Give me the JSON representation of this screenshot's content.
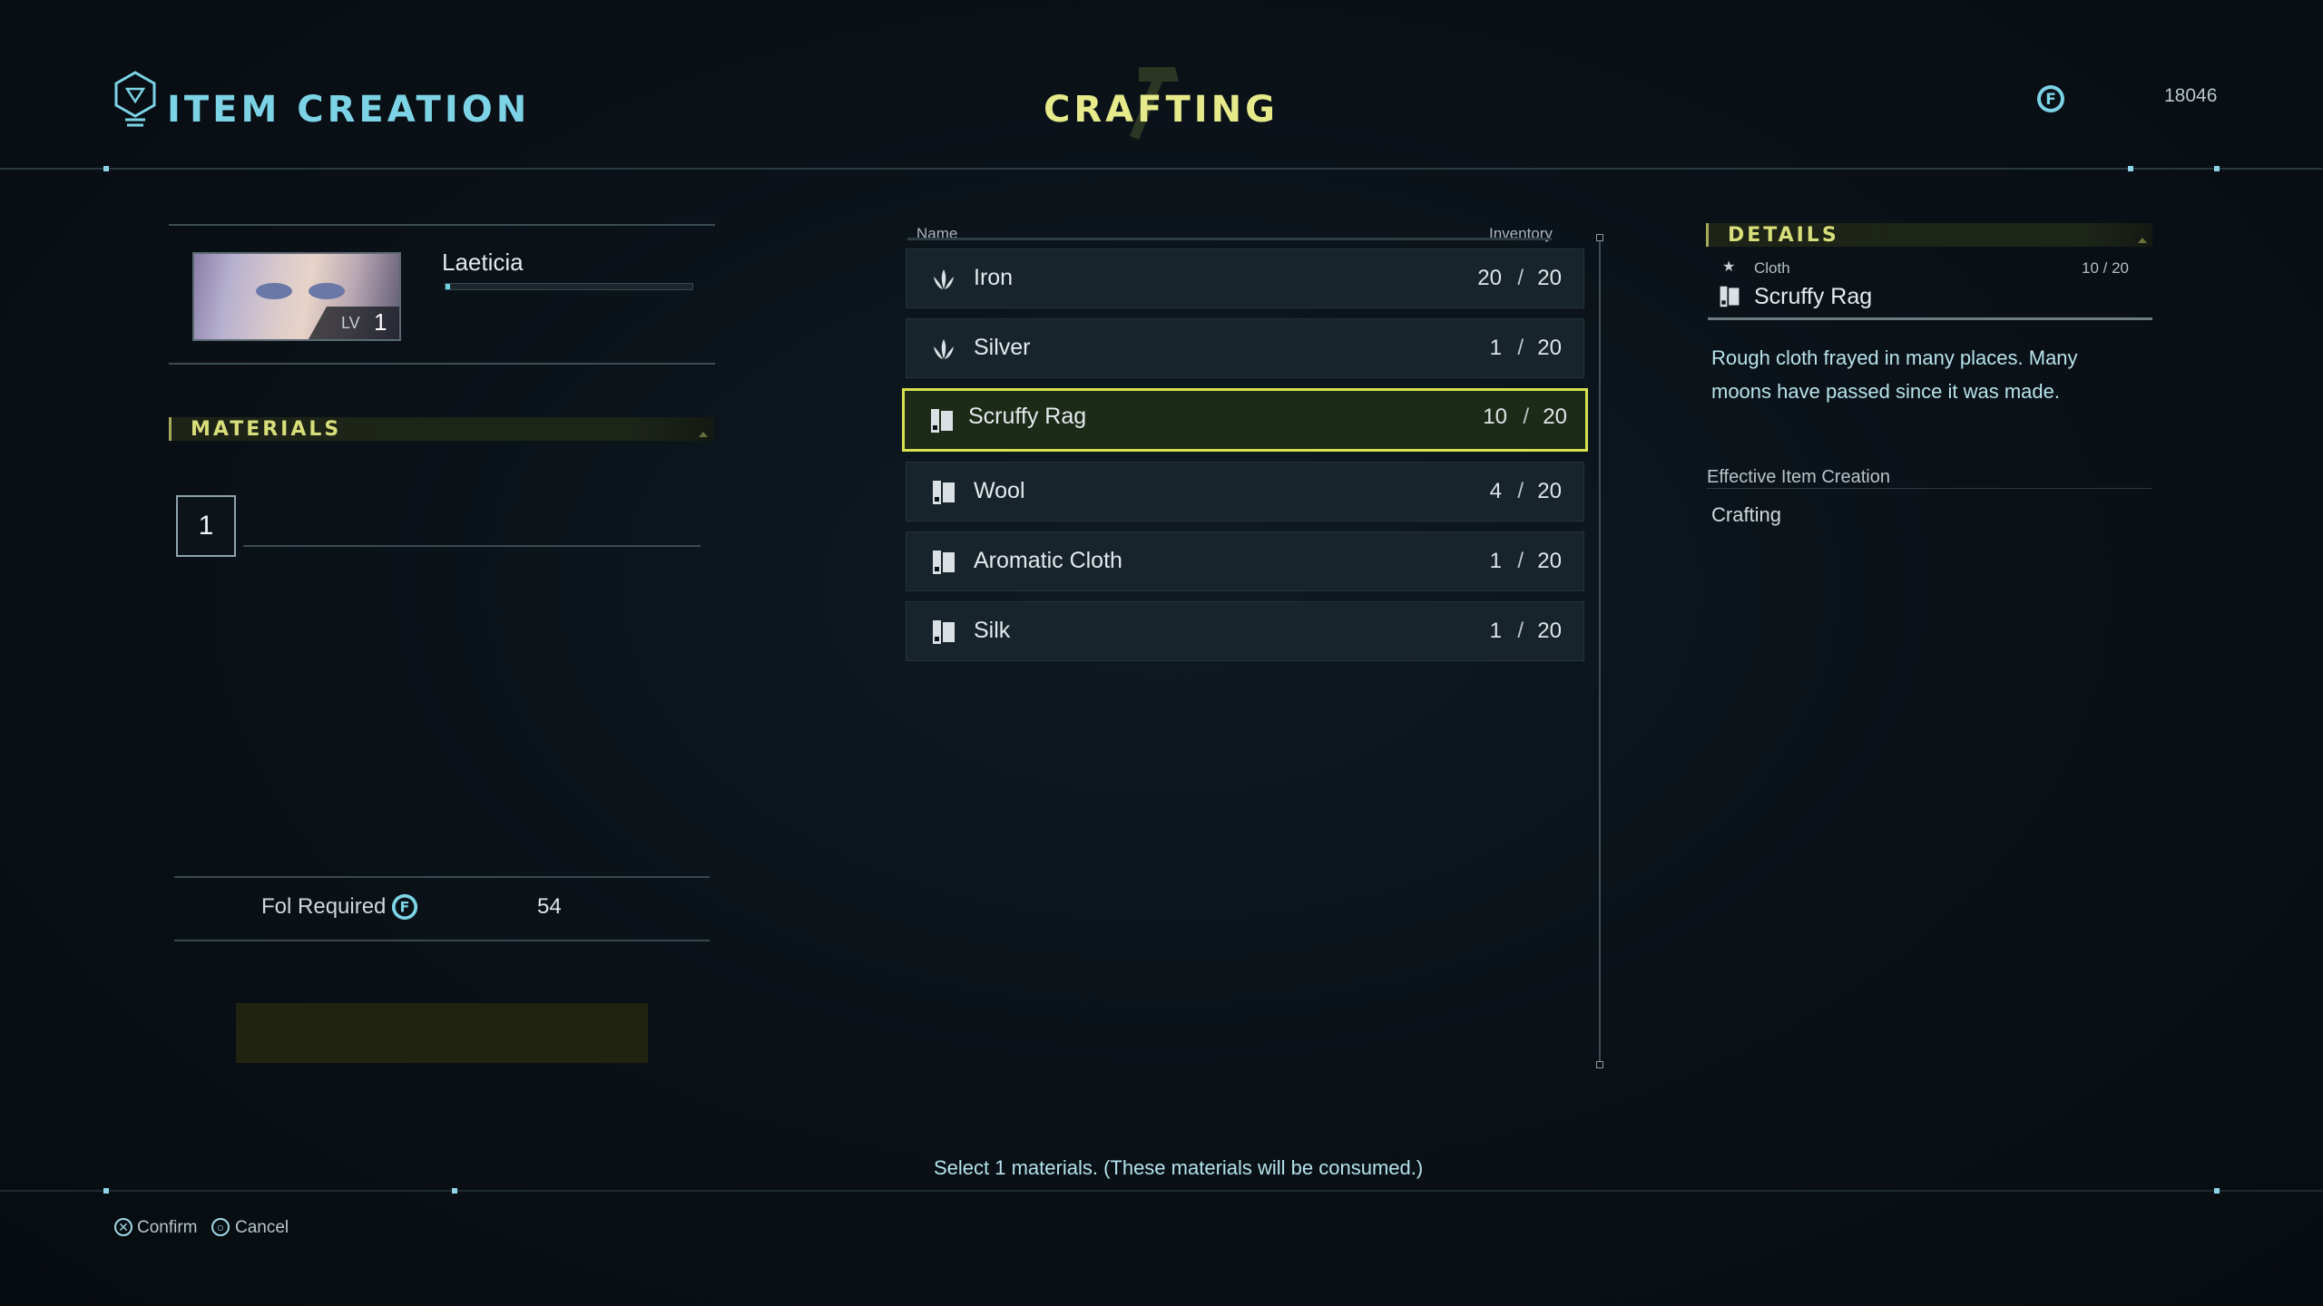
{
  "header": {
    "section_title": "ITEM CREATION",
    "tab_title": "CRAFTING",
    "fol_amount": "18046",
    "icons": [
      "hexagon-emblem-icon",
      "hammer-icon",
      "fol-currency-icon"
    ]
  },
  "character": {
    "name": "Laeticia",
    "level_label": "LV",
    "level": "1",
    "exp_fraction": 0.02
  },
  "materials": {
    "header": "MATERIALS",
    "slot_number": "1"
  },
  "fol_required": {
    "label": "Fol Required",
    "value": "54"
  },
  "list": {
    "col_name": "Name",
    "col_inventory": "Inventory",
    "selected_index": 2,
    "items": [
      {
        "name": "Iron",
        "count": "20",
        "max": "20",
        "icon": "ore-icon"
      },
      {
        "name": "Silver",
        "count": "1",
        "max": "20",
        "icon": "ore-icon"
      },
      {
        "name": "Scruffy Rag",
        "count": "10",
        "max": "20",
        "icon": "cloth-icon"
      },
      {
        "name": "Wool",
        "count": "4",
        "max": "20",
        "icon": "cloth-icon"
      },
      {
        "name": "Aromatic Cloth",
        "count": "1",
        "max": "20",
        "icon": "cloth-icon"
      },
      {
        "name": "Silk",
        "count": "1",
        "max": "20",
        "icon": "cloth-icon"
      }
    ],
    "separator": "/"
  },
  "details": {
    "header": "DETAILS",
    "category": "Cloth",
    "count": "10",
    "max": "20",
    "count_text": "10  /  20",
    "item_name": "Scruffy Rag",
    "description": "Rough cloth frayed in many places. Many moons have passed since it was made.",
    "effective_label": "Effective Item Creation",
    "effective_value": "Crafting"
  },
  "hint": "Select 1 materials. (These materials will be consumed.)",
  "footer": {
    "confirm_label": "Confirm",
    "cancel_label": "Cancel",
    "confirm_glyph": "✕",
    "cancel_glyph": "○"
  },
  "colors": {
    "accent_cyan": "#7dd3e6",
    "accent_yellow": "#e6ea8a",
    "selection_border": "#d6e14f",
    "background": "#0a1117"
  }
}
